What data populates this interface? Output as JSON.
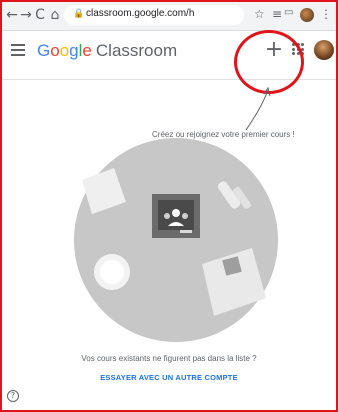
{
  "browser": {
    "back_glyph": "←",
    "forward_glyph": "→",
    "reload_glyph": "C",
    "home_glyph": "⌂",
    "url": "classroom.google.com/h",
    "star_glyph": "☆",
    "menu_glyph": "⋮"
  },
  "header": {
    "logo_letters": [
      "G",
      "o",
      "o",
      "g",
      "l",
      "e"
    ],
    "product": "Classroom",
    "plus_glyph": "+"
  },
  "main": {
    "prompt": "Créez ou rejoignez votre premier cours !",
    "not_listed": "Vos cours existants ne figurent pas dans la liste ?",
    "other_account": "ESSAYER AVEC UN AUTRE COMPTE"
  },
  "footer": {
    "help_glyph": "?"
  },
  "colors": {
    "annotation_red": "#e0141b",
    "link_blue": "#1a73e8",
    "illustration_gray": "#c7c7c7"
  },
  "icons": [
    "back-arrow-icon",
    "forward-arrow-icon",
    "reload-icon",
    "home-icon",
    "lock-icon",
    "star-icon",
    "reading-list-icon",
    "extension-avatar-icon",
    "menu-kebab-icon",
    "hamburger-icon",
    "plus-icon",
    "apps-grid-icon",
    "help-icon",
    "classroom-board-icon"
  ]
}
